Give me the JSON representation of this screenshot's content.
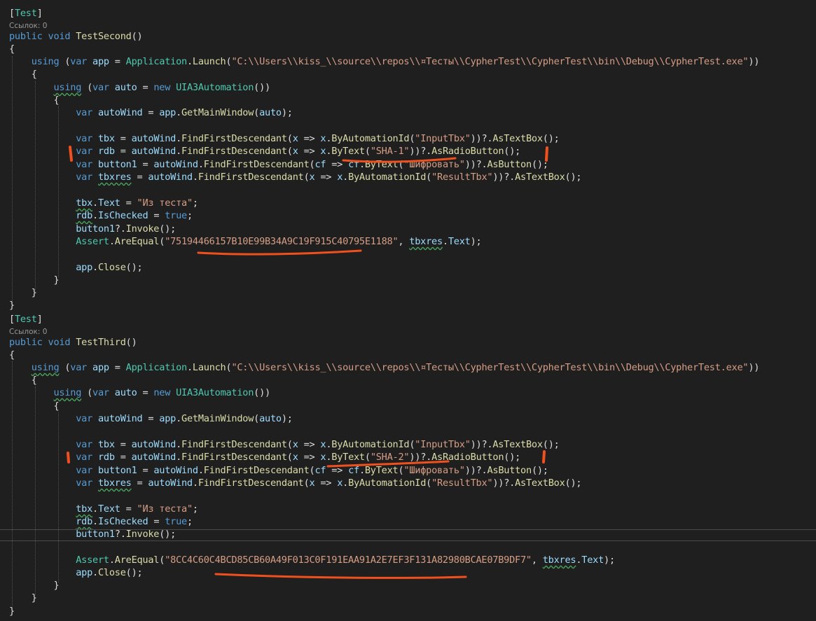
{
  "codelens": {
    "refs_second": "Ссылок: 0",
    "refs_third": "Ссылок: 0"
  },
  "code": {
    "attr": "Test",
    "kw_public": "public",
    "kw_void": "void",
    "method_second": "TestSecond",
    "method_third": "TestThird",
    "kw_using": "using",
    "kw_var": "var",
    "kw_new": "new",
    "kw_true": "true",
    "var_app": "app",
    "var_auto": "auto",
    "var_autoWind": "autoWind",
    "var_tbx": "tbx",
    "var_rdb": "rdb",
    "var_button1": "button1",
    "var_tbxres": "tbxres",
    "param_x": "x",
    "param_cf": "cf",
    "type_application": "Application",
    "type_uia3": "UIA3Automation",
    "type_assert": "Assert",
    "m_launch": "Launch",
    "m_getmain": "GetMainWindow",
    "m_findfirst": "FindFirstDescendant",
    "m_byautoid": "ByAutomationId",
    "m_bytext": "ByText",
    "m_astextbox": "AsTextBox",
    "m_asradio": "AsRadioButton",
    "m_asbutton": "AsButton",
    "m_invoke": "Invoke",
    "m_areequal": "AreEqual",
    "m_close": "Close",
    "prop_text": "Text",
    "prop_ischecked": "IsChecked",
    "str_path": "\"C:\\\\Users\\\\kiss_\\\\source\\\\repos\\\\¤Тесты\\\\CypherTest\\\\CypherTest\\\\bin\\\\Debug\\\\CypherTest.exe\"",
    "str_inputtbx": "\"InputTbx\"",
    "str_resulttbx": "\"ResultTbx\"",
    "str_sha1": "\"SHA-1\"",
    "str_sha2": "\"SHA-2\"",
    "str_encrypt": "\"Шифровать\"",
    "str_fromtest": "\"Из теста\"",
    "str_hash1": "\"75194466157B10E99B34A9C19F915C40795E1188\"",
    "str_hash2": "\"8CC4C60C4BCD85CB60A49F013C0F191EAA91A2E7EF3F131A82980BCAE07B9DF7\""
  },
  "colors": {
    "background": "#1f1f1f",
    "keyword": "#569cd6",
    "type": "#4ec9b0",
    "method": "#dcdcaa",
    "string": "#d69d85",
    "variable": "#9cdcfe",
    "annotation": "#f0501e"
  }
}
